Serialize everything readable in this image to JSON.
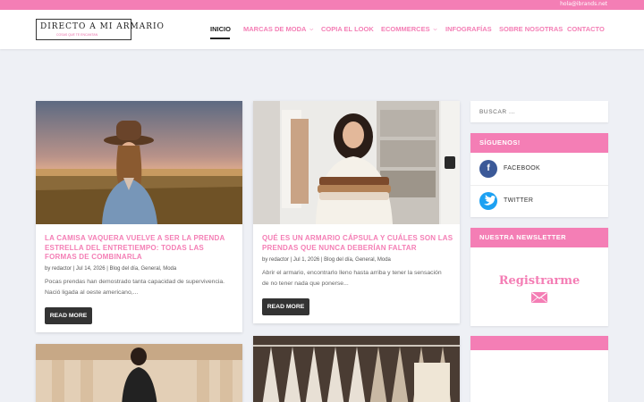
{
  "topbar": {
    "email": "hola@ibrands.net"
  },
  "logo": {
    "title": "DIRECTO A MI ARMARIO",
    "tagline": "COSAS QUE TE ENCANTAN"
  },
  "nav": {
    "items": [
      {
        "label": "INICIO",
        "active": true
      },
      {
        "label": "MARCAS DE MODA",
        "dropdown": true
      },
      {
        "label": "COPIA EL LOOK"
      },
      {
        "label": "ECOMMERCES",
        "dropdown": true
      },
      {
        "label": "INFOGRAFÍAS"
      },
      {
        "label": "SOBRE NOSOTRAS"
      },
      {
        "label": "CONTACTO"
      }
    ]
  },
  "posts": [
    {
      "title": "LA CAMISA VAQUERA VUELVE A SER LA PRENDA ESTRELLA DEL ENTRETIEMPO: TODAS LAS FORMAS DE COMBINARLA",
      "meta": "by redactor | Jul 14, 2026 | Blog del día, General, Moda",
      "excerpt": "Pocas prendas han demostrado tanta capacidad de supervivencia. Nació ligada al oeste americano,...",
      "button": "READ MORE"
    },
    {
      "title": "QUÉ ES UN ARMARIO CÁPSULA Y CUÁLES SON LAS PRENDAS QUE NUNCA DEBERÍAN FALTAR",
      "meta": "by redactor | Jul 1, 2026 | Blog del día, General, Moda",
      "excerpt": "Abrir el armario, encontrarlo lleno hasta arriba y tener la sensación de no tener nada que ponerse...",
      "button": "READ MORE"
    }
  ],
  "sidebar": {
    "search_placeholder": "BUSCAR ...",
    "follow_title": "SÍGUENOS!",
    "social": [
      {
        "label": "FACEBOOK",
        "icon": "facebook-icon",
        "color": "#3b5998"
      },
      {
        "label": "TWITTER",
        "icon": "twitter-icon",
        "color": "#1da1f2"
      }
    ],
    "newsletter_title": "NUESTRA NEWSLETTER",
    "newsletter_cta": "Registrarme"
  },
  "colors": {
    "accent": "#f47eb5",
    "dark": "#333333",
    "background": "#eef0f5"
  }
}
